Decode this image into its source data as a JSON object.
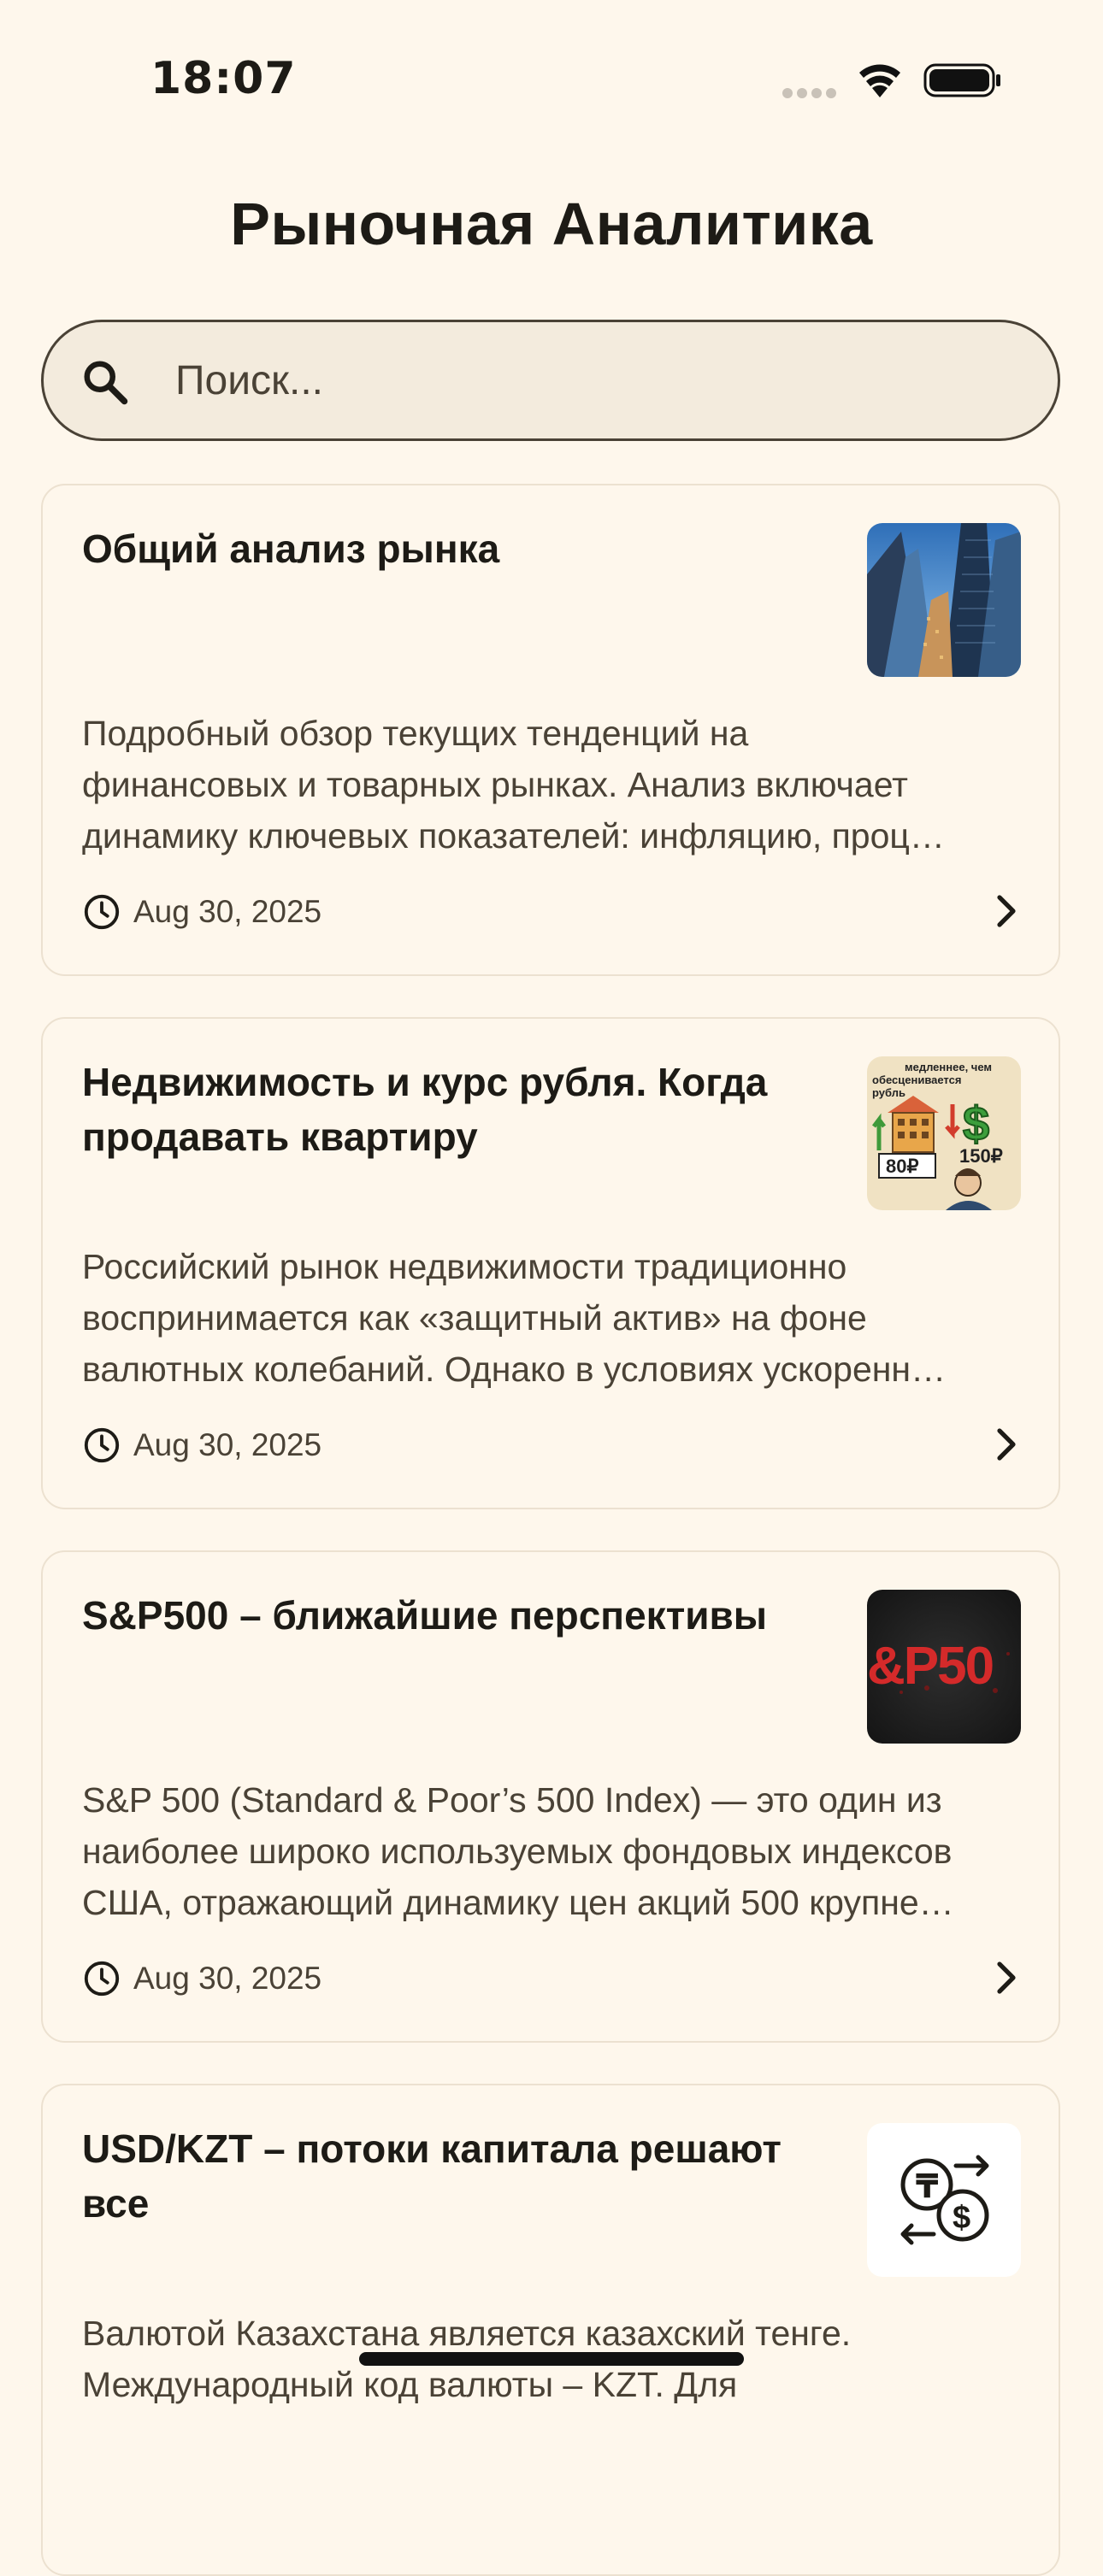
{
  "status_bar": {
    "time": "18:07"
  },
  "header": {
    "title": "Рыночная Аналитика"
  },
  "search": {
    "placeholder": "Поиск..."
  },
  "articles": [
    {
      "title": "Общий анализ рынка",
      "description_lines": [
        "Подробный обзор текущих тенденций на",
        "финансовых и товарных рынках. Анализ включает",
        "динамику ключевых показателей: инфляцию, проц…"
      ],
      "date": "Aug 30, 2025",
      "thumbnail": "city-skyscrapers-image"
    },
    {
      "title_lines": [
        "Недвижимость и курс рубля. Когда",
        "продавать квартиру"
      ],
      "description_lines": [
        "Российский рынок недвижимости традиционно",
        "воспринимается как «защитный актив» на фоне",
        "валютных колебаний. Однако в условиях ускоренн…"
      ],
      "date": "Aug 30, 2025",
      "thumbnail": "real-estate-ruble-illustration",
      "thumbnail_text": {
        "caption_line1": "медленнее, чем",
        "caption_line2": "обесценивается",
        "caption_line3": "рубль",
        "price_left": "80₽",
        "price_right": "150₽"
      }
    },
    {
      "title": "S&P500 – ближайшие перспективы",
      "description_lines": [
        "S&P 500 (Standard & Poor’s 500 Index) — это один из",
        "наиболее широко используемых фондовых индексов",
        "США, отражающий динамику цен акций 500 крупне…"
      ],
      "date": "Aug 30, 2025",
      "thumbnail": "sp500-logo-image",
      "thumbnail_text": "&P50"
    },
    {
      "title_lines": [
        "USD/KZT – потоки капитала решают",
        "все"
      ],
      "description_lines": [
        "Валютой Казахстана является казахский тенге.",
        "Международный код валюты – KZT. Для"
      ],
      "thumbnail": "currency-exchange-icon"
    }
  ],
  "colors": {
    "background": "#FEF7EC",
    "text_primary": "#1D1B16",
    "text_secondary": "#4A4236",
    "card_border": "#ECE1D0",
    "search_fill": "#F3EBDD"
  }
}
